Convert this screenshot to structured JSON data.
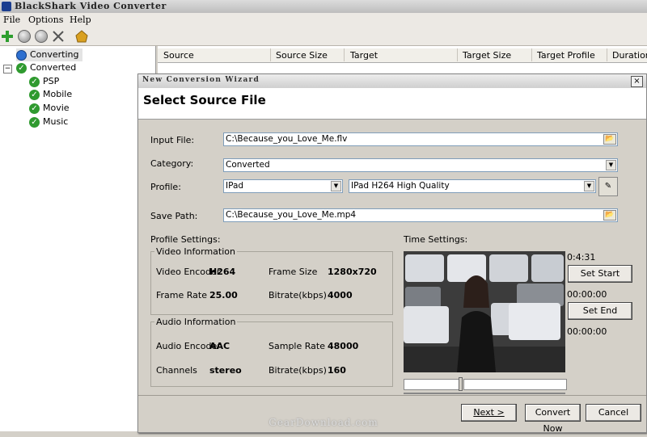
{
  "app": {
    "title": "BlackShark Video Converter"
  },
  "menu": [
    "File",
    "Options",
    "Help"
  ],
  "toolbar": {
    "icons": [
      "add-icon",
      "play-icon",
      "pause-icon",
      "delete-icon",
      "settings-icon"
    ],
    "colors": {
      "add": "#2e9e2e",
      "delete": "#555555",
      "settings": "#d9a020"
    }
  },
  "tree": {
    "converting": "Converting",
    "converted": "Converted",
    "children": [
      "PSP",
      "Mobile",
      "Movie",
      "Music"
    ],
    "expander": "−"
  },
  "list": {
    "columns": [
      "Source",
      "Source Size",
      "Target",
      "Target Size",
      "Target Profile",
      "Duration"
    ]
  },
  "dialog": {
    "title": "New Conversion Wizard",
    "close": "×",
    "heading": "Select Source File",
    "input_label": "Input File:",
    "input_value": "C:\\Because_you_Love_Me.flv",
    "category_label": "Category:",
    "category_value": "Converted",
    "profile_label": "Profile:",
    "profile_device": "IPad",
    "profile_quality": "IPad H264 High Quality",
    "savepath_label": "Save Path:",
    "savepath_value": "C:\\Because_you_Love_Me.mp4",
    "profile_settings_label": "Profile Settings:",
    "video": {
      "group": "Video Information",
      "encoder_label": "Video Encoder",
      "encoder_value": "H264",
      "framesize_label": "Frame Size",
      "framesize_value": "1280x720",
      "framerate_label": "Frame Rate",
      "framerate_value": "25.00",
      "bitrate_label": "Bitrate(kbps)",
      "bitrate_value": "4000"
    },
    "audio": {
      "group": "Audio Information",
      "encoder_label": "Audio Encoder",
      "encoder_value": "AAC",
      "samplerate_label": "Sample Rate",
      "samplerate_value": "48000",
      "channels_label": "Channels",
      "channels_value": "stereo",
      "bitrate_label": "Bitrate(kbps)",
      "bitrate_value": "160"
    },
    "time": {
      "label": "Time Settings:",
      "duration": "0:4:31",
      "set_start": "Set Start",
      "start_time": "00:00:00",
      "set_end": "Set End",
      "end_time": "00:00:00"
    },
    "buttons": {
      "next": "Next >",
      "convert": "Convert Now",
      "cancel": "Cancel"
    }
  },
  "watermark": "GearDownload.com"
}
